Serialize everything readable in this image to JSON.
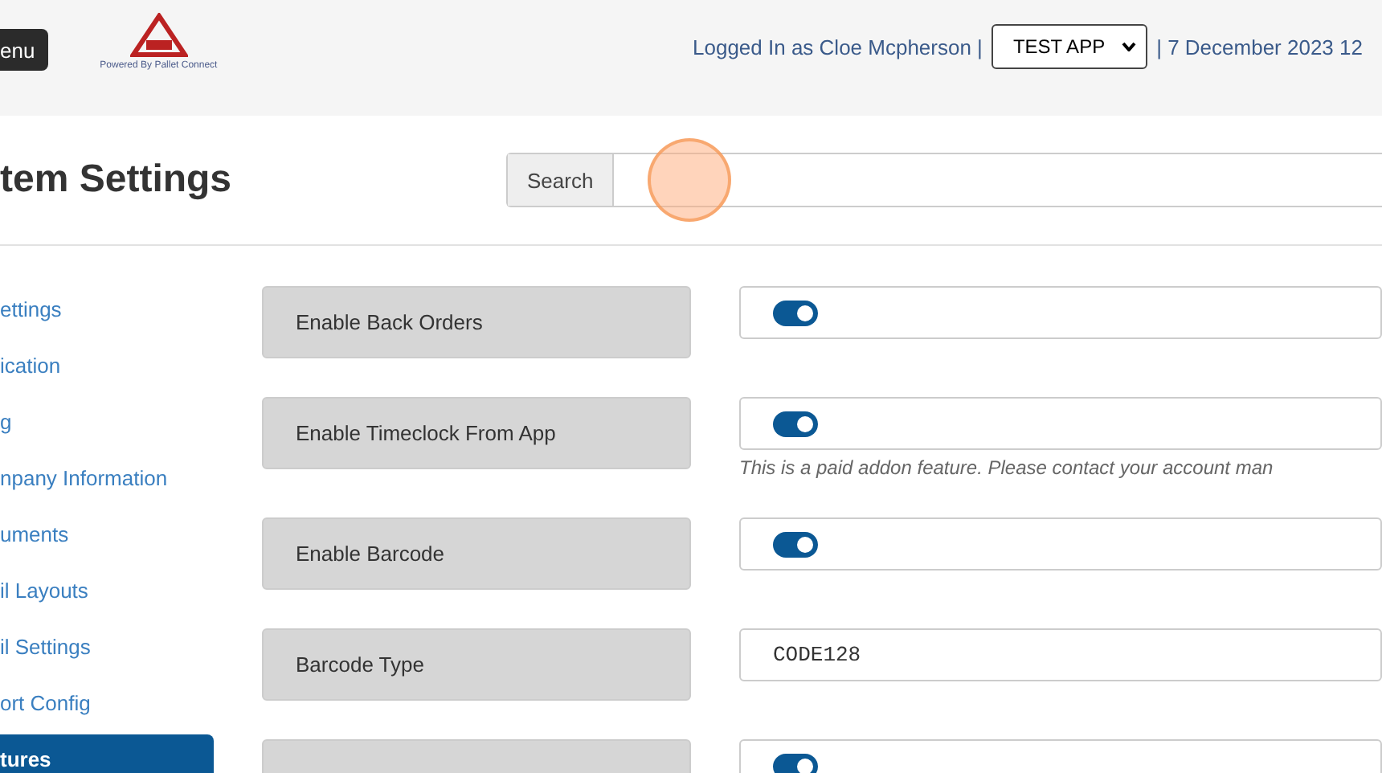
{
  "header": {
    "menu_button": "enu",
    "logo_caption": "Powered By Pallet Connect",
    "logged_in": "Logged In as Cloe Mcpherson |",
    "app_select": "TEST APP",
    "date": "| 7 December 2023 12"
  },
  "page_title": "tem Settings",
  "search": {
    "label": "Search"
  },
  "sidebar": {
    "items": [
      {
        "label": "ettings",
        "selected": false
      },
      {
        "label": "ication",
        "selected": false
      },
      {
        "label": "g",
        "selected": false
      },
      {
        "label": "npany Information",
        "selected": false
      },
      {
        "label": "uments",
        "selected": false
      },
      {
        "label": "il Layouts",
        "selected": false
      },
      {
        "label": "il Settings",
        "selected": false
      },
      {
        "label": "ort Config",
        "selected": false
      },
      {
        "label": "tures",
        "selected": true
      }
    ]
  },
  "settings": [
    {
      "kind": "toggle",
      "label": "Enable Back Orders",
      "on": true
    },
    {
      "kind": "toggle",
      "label": "Enable Timeclock From App",
      "on": true,
      "note": "This is a paid addon feature. Please contact your account man"
    },
    {
      "kind": "toggle",
      "label": "Enable Barcode",
      "on": true
    },
    {
      "kind": "text",
      "label": "Barcode Type",
      "value": "CODE128"
    },
    {
      "kind": "toggle",
      "on": true
    }
  ]
}
